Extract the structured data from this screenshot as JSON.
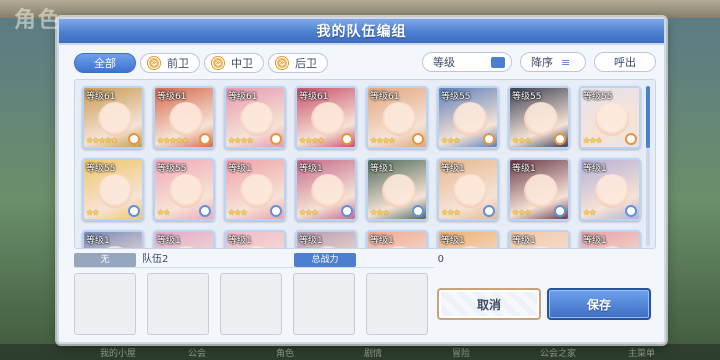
{
  "background": {
    "corner_label": "角色",
    "bottom_items": [
      "我的小屋",
      "公会",
      "角色",
      "剧情",
      "冒险",
      "公会之家",
      "主菜单"
    ]
  },
  "dialog": {
    "title": "我的队伍编组",
    "close_icon": "×"
  },
  "filters": {
    "all": "全部",
    "front": "前卫",
    "middle": "中卫",
    "back": "后卫"
  },
  "sort": {
    "level": "等级",
    "order": "降序",
    "call": "呼出"
  },
  "roster": {
    "cards": [
      {
        "level": "等级61",
        "stars": "★★★★★",
        "rank": "orange",
        "bg": "#c89a52"
      },
      {
        "level": "等级61",
        "stars": "★★★★★",
        "rank": "orange",
        "bg": "#d46a4c"
      },
      {
        "level": "等级61",
        "stars": "★★★★",
        "rank": "orange",
        "bg": "#e79ab0"
      },
      {
        "level": "等级61",
        "stars": "★★★★",
        "rank": "orange",
        "bg": "#c8506a"
      },
      {
        "level": "等级61",
        "stars": "★★★★",
        "rank": "orange",
        "bg": "#e2a57e"
      },
      {
        "level": "等级55",
        "stars": "★★★",
        "rank": "orange",
        "bg": "#5c7fb8"
      },
      {
        "level": "等级55",
        "stars": "★★★",
        "rank": "orange",
        "bg": "#3c3f52"
      },
      {
        "level": "等级55",
        "stars": "★★★",
        "rank": "orange",
        "bg": "#e8e2ea"
      },
      {
        "level": "等级55",
        "stars": "★★",
        "rank": "blue",
        "bg": "#f0c86a"
      },
      {
        "level": "等级55",
        "stars": "★★",
        "rank": "blue",
        "bg": "#f2a8b8"
      },
      {
        "level": "等级1",
        "stars": "★★★",
        "rank": "blue",
        "bg": "#f0a0a8"
      },
      {
        "level": "等级1",
        "stars": "★★★",
        "rank": "blue",
        "bg": "#c66a8a"
      },
      {
        "level": "等级1",
        "stars": "★★★",
        "rank": "blue",
        "bg": "#4e6a5a"
      },
      {
        "level": "等级1",
        "stars": "★★★",
        "rank": "blue",
        "bg": "#e8b890"
      },
      {
        "level": "等级1",
        "stars": "★★★",
        "rank": "blue",
        "bg": "#6a3a4a"
      },
      {
        "level": "等级1",
        "stars": "★★",
        "rank": "blue",
        "bg": "#b8b0d8"
      },
      {
        "level": "等级1",
        "stars": "",
        "rank": "blue",
        "bg": "#7a8ab8"
      },
      {
        "level": "等级1",
        "stars": "",
        "rank": "blue",
        "bg": "#e0a8c8"
      },
      {
        "level": "等级1",
        "stars": "",
        "rank": "blue",
        "bg": "#f2b8c8"
      },
      {
        "level": "等级1",
        "stars": "",
        "rank": "blue",
        "bg": "#b89ab0"
      },
      {
        "level": "等级1",
        "stars": "",
        "rank": "blue",
        "bg": "#f0a890"
      },
      {
        "level": "等级1",
        "stars": "",
        "rank": "blue",
        "bg": "#f0b070"
      },
      {
        "level": "等级1",
        "stars": "",
        "rank": "blue",
        "bg": "#f0c8a8"
      },
      {
        "level": "等级1",
        "stars": "",
        "rank": "blue",
        "bg": "#e8a0a8"
      }
    ]
  },
  "party": {
    "none_tag": "无",
    "name": "队伍2",
    "power_tag": "总战力",
    "power_value": "0"
  },
  "actions": {
    "cancel": "取消",
    "save": "保存"
  }
}
